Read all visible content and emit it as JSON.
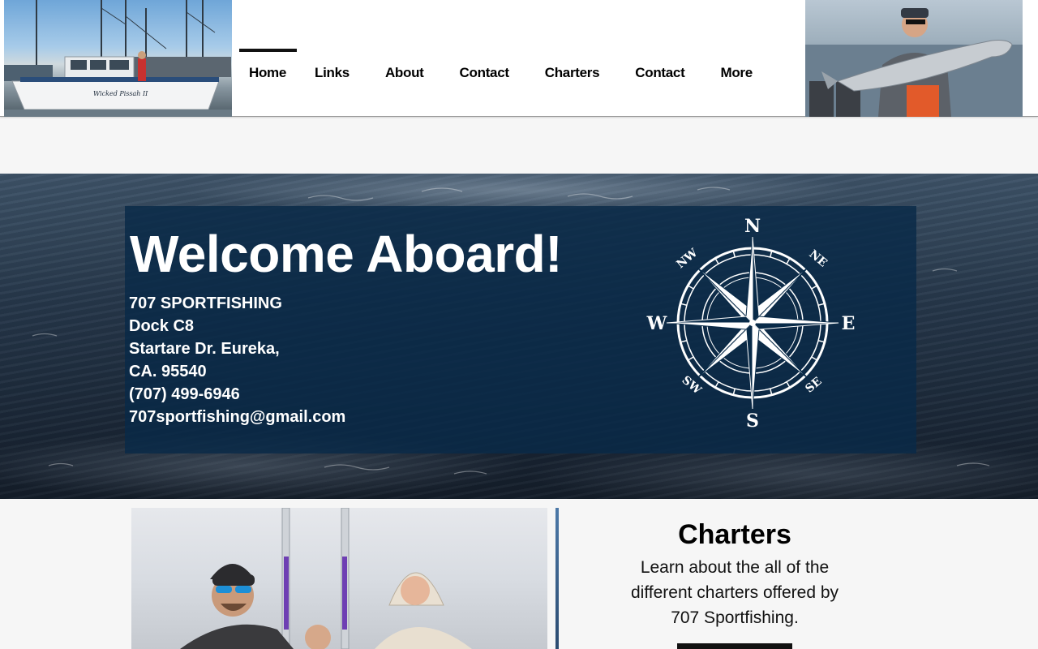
{
  "nav": {
    "items": [
      {
        "label": "Home",
        "active": true
      },
      {
        "label": "Links"
      },
      {
        "label": "About"
      },
      {
        "label": "Contact"
      },
      {
        "label": "Charters"
      },
      {
        "label": "Contact"
      },
      {
        "label": "More"
      }
    ]
  },
  "hero": {
    "title": "Welcome Aboard!",
    "business_name": "707 SPORTFISHING",
    "dock": "Dock C8",
    "street": "Startare Dr. Eureka,",
    "state_zip": "CA. 95540",
    "phone": "(707) 499-6946",
    "email": "707sportfishing@gmail.com",
    "compass": {
      "n": "N",
      "s": "S",
      "e": "E",
      "w": "W",
      "ne": "NE",
      "nw": "NW",
      "se": "SE",
      "sw": "SW"
    }
  },
  "charters": {
    "title": "Charters",
    "line1": "Learn about the all of the",
    "line2": "different charters offered by",
    "line3": "707 Sportfishing."
  },
  "boat_name": "Wicked Pissah II",
  "colors": {
    "panel": "#082a48",
    "accent": "#111111"
  }
}
